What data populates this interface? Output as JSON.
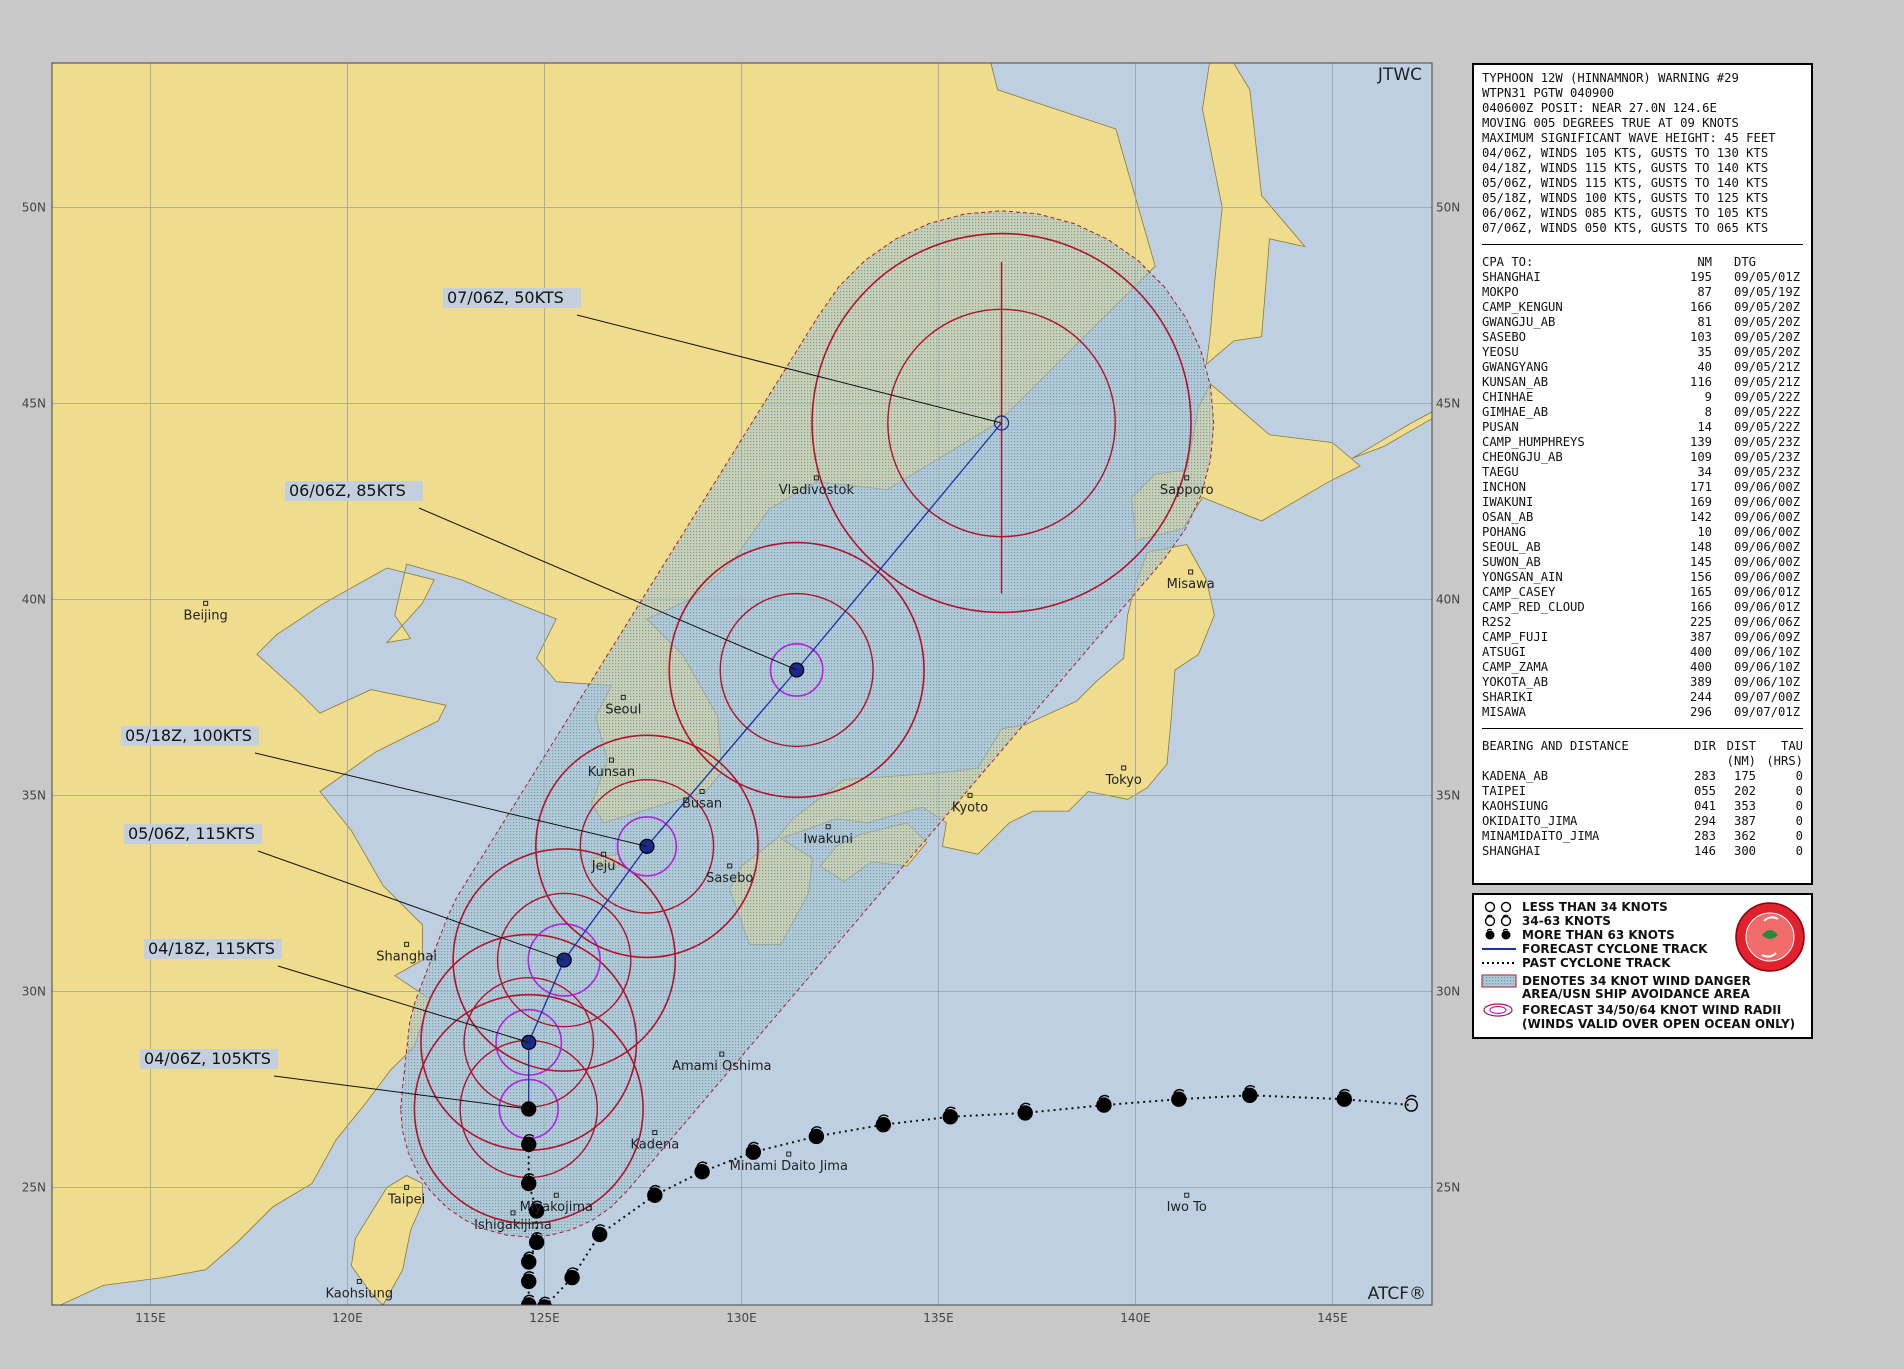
{
  "map": {
    "agency": "JTWC",
    "footer": "ATCF®",
    "lat_labels": [
      "50N",
      "45N",
      "40N",
      "35N",
      "30N",
      "25N"
    ],
    "lon_labels": [
      "115E",
      "120E",
      "125E",
      "130E",
      "135E",
      "140E",
      "145E"
    ],
    "colors": {
      "land": "#efdc8c",
      "sea": "#bdcfe0",
      "danger_area": "#a9c9d6",
      "radii": "#b0142a",
      "inner_radii": "#b023e0",
      "track": "#1a33a6"
    },
    "cities": [
      {
        "name": "Beijing",
        "lon": 116.4,
        "lat": 39.9
      },
      {
        "name": "Shanghai",
        "lon": 121.5,
        "lat": 31.2
      },
      {
        "name": "Taipei",
        "lon": 121.5,
        "lat": 25.0
      },
      {
        "name": "Kaohsiung",
        "lon": 120.3,
        "lat": 22.6
      },
      {
        "name": "Seoul",
        "lon": 127.0,
        "lat": 37.5
      },
      {
        "name": "Kunsan",
        "lon": 126.7,
        "lat": 35.9
      },
      {
        "name": "Busan",
        "lon": 129.0,
        "lat": 35.1
      },
      {
        "name": "Jeju",
        "lon": 126.5,
        "lat": 33.5
      },
      {
        "name": "Sasebo",
        "lon": 129.7,
        "lat": 33.2
      },
      {
        "name": "Iwakuni",
        "lon": 132.2,
        "lat": 34.2
      },
      {
        "name": "Kyoto",
        "lon": 135.8,
        "lat": 35.0
      },
      {
        "name": "Tokyo",
        "lon": 139.7,
        "lat": 35.7
      },
      {
        "name": "Misawa",
        "lon": 141.4,
        "lat": 40.7
      },
      {
        "name": "Sapporo",
        "lon": 141.3,
        "lat": 43.1
      },
      {
        "name": "Vladivostok",
        "lon": 131.9,
        "lat": 43.1
      },
      {
        "name": "Amami Oshima",
        "lon": 129.5,
        "lat": 28.4
      },
      {
        "name": "Kadena",
        "lon": 127.8,
        "lat": 26.4
      },
      {
        "name": "Minami Daito Jima",
        "lon": 131.2,
        "lat": 25.85
      },
      {
        "name": "Iwo To",
        "lon": 141.3,
        "lat": 24.8
      },
      {
        "name": "Miyakojima",
        "lon": 125.3,
        "lat": 24.8
      },
      {
        "name": "Ishigakijima",
        "lon": 124.2,
        "lat": 24.35
      }
    ],
    "forecast_positions": [
      {
        "label": "04/06Z, 105KTS",
        "lon": 124.6,
        "lat": 27.0,
        "r34_nm": 175,
        "r64_nm": 45
      },
      {
        "label": "04/18Z, 115KTS",
        "lon": 124.6,
        "lat": 28.7,
        "r34_nm": 165,
        "r64_nm": 50
      },
      {
        "label": "05/06Z, 115KTS",
        "lon": 125.5,
        "lat": 30.8,
        "r34_nm": 170,
        "r64_nm": 55
      },
      {
        "label": "05/18Z, 100KTS",
        "lon": 127.6,
        "lat": 33.7,
        "r34_nm": 170,
        "r64_nm": 45
      },
      {
        "label": "06/06Z, 85KTS",
        "lon": 131.4,
        "lat": 38.2,
        "r34_nm": 195,
        "r64_nm": 40
      },
      {
        "label": "07/06Z, 50KTS",
        "lon": 136.6,
        "lat": 44.5,
        "r34_nm": 290,
        "r64_nm": 0
      }
    ],
    "past_track": [
      {
        "lon": 124.6,
        "lat": 26.1
      },
      {
        "lon": 124.6,
        "lat": 25.1
      },
      {
        "lon": 124.8,
        "lat": 24.4
      },
      {
        "lon": 124.8,
        "lat": 23.6
      },
      {
        "lon": 124.6,
        "lat": 23.1
      },
      {
        "lon": 124.6,
        "lat": 22.6
      },
      {
        "lon": 124.6,
        "lat": 22.0
      },
      {
        "lon": 125.0,
        "lat": 21.95
      },
      {
        "lon": 125.7,
        "lat": 22.7
      },
      {
        "lon": 126.4,
        "lat": 23.8
      },
      {
        "lon": 127.8,
        "lat": 24.8
      },
      {
        "lon": 129.0,
        "lat": 25.4
      },
      {
        "lon": 130.3,
        "lat": 25.9
      },
      {
        "lon": 131.9,
        "lat": 26.3
      },
      {
        "lon": 133.6,
        "lat": 26.6
      },
      {
        "lon": 135.3,
        "lat": 26.8
      },
      {
        "lon": 137.2,
        "lat": 26.9
      },
      {
        "lon": 139.2,
        "lat": 27.1
      },
      {
        "lon": 141.1,
        "lat": 27.25
      },
      {
        "lon": 142.9,
        "lat": 27.35
      },
      {
        "lon": 145.3,
        "lat": 27.25
      },
      {
        "lon": 147.0,
        "lat": 27.1
      }
    ]
  },
  "warning": {
    "header_lines": [
      "TYPHOON 12W (HINNAMNOR) WARNING #29",
      "WTPN31 PGTW 040900",
      "040600Z POSIT: NEAR 27.0N 124.6E",
      "MOVING 005 DEGREES TRUE AT 09 KNOTS",
      "MAXIMUM SIGNIFICANT WAVE HEIGHT: 45 FEET",
      "04/06Z, WINDS 105 KTS, GUSTS TO 130 KTS",
      "04/18Z, WINDS 115 KTS, GUSTS TO 140 KTS",
      "05/06Z, WINDS 115 KTS, GUSTS TO 140 KTS",
      "05/18Z, WINDS 100 KTS, GUSTS TO 125 KTS",
      "06/06Z, WINDS 085 KTS, GUSTS TO 105 KTS",
      "07/06Z, WINDS 050 KTS, GUSTS TO 065 KTS"
    ],
    "cpa_header": [
      "CPA TO:",
      "NM",
      "DTG"
    ],
    "cpa_rows": [
      [
        "SHANGHAI",
        "195",
        "09/05/01Z"
      ],
      [
        "MOKPO",
        "87",
        "09/05/19Z"
      ],
      [
        "CAMP_KENGUN",
        "166",
        "09/05/20Z"
      ],
      [
        "GWANGJU_AB",
        "81",
        "09/05/20Z"
      ],
      [
        "SASEBO",
        "103",
        "09/05/20Z"
      ],
      [
        "YEOSU",
        "35",
        "09/05/20Z"
      ],
      [
        "GWANGYANG",
        "40",
        "09/05/21Z"
      ],
      [
        "KUNSAN_AB",
        "116",
        "09/05/21Z"
      ],
      [
        "CHINHAE",
        "9",
        "09/05/22Z"
      ],
      [
        "GIMHAE_AB",
        "8",
        "09/05/22Z"
      ],
      [
        "PUSAN",
        "14",
        "09/05/22Z"
      ],
      [
        "CAMP_HUMPHREYS",
        "139",
        "09/05/23Z"
      ],
      [
        "CHEONGJU_AB",
        "109",
        "09/05/23Z"
      ],
      [
        "TAEGU",
        "34",
        "09/05/23Z"
      ],
      [
        "INCHON",
        "171",
        "09/06/00Z"
      ],
      [
        "IWAKUNI",
        "169",
        "09/06/00Z"
      ],
      [
        "OSAN_AB",
        "142",
        "09/06/00Z"
      ],
      [
        "POHANG",
        "10",
        "09/06/00Z"
      ],
      [
        "SEOUL_AB",
        "148",
        "09/06/00Z"
      ],
      [
        "SUWON_AB",
        "145",
        "09/06/00Z"
      ],
      [
        "YONGSAN_AIN",
        "156",
        "09/06/00Z"
      ],
      [
        "CAMP_CASEY",
        "165",
        "09/06/01Z"
      ],
      [
        "CAMP_RED_CLOUD",
        "166",
        "09/06/01Z"
      ],
      [
        "R2S2",
        "225",
        "09/06/06Z"
      ],
      [
        "CAMP_FUJI",
        "387",
        "09/06/09Z"
      ],
      [
        "ATSUGI",
        "400",
        "09/06/10Z"
      ],
      [
        "CAMP_ZAMA",
        "400",
        "09/06/10Z"
      ],
      [
        "YOKOTA_AB",
        "389",
        "09/06/10Z"
      ],
      [
        "SHARIKI",
        "244",
        "09/07/00Z"
      ],
      [
        "MISAWA",
        "296",
        "09/07/01Z"
      ]
    ],
    "bd_header": [
      "BEARING AND DISTANCE",
      "DIR",
      "DIST",
      "TAU"
    ],
    "bd_header2": [
      "",
      "",
      "(NM)",
      "(HRS)"
    ],
    "bd_rows": [
      [
        "KADENA_AB",
        "283",
        "175",
        "0"
      ],
      [
        "TAIPEI",
        "055",
        "202",
        "0"
      ],
      [
        "KAOHSIUNG",
        "041",
        "353",
        "0"
      ],
      [
        "OKIDAITO_JIMA",
        "294",
        "387",
        "0"
      ],
      [
        "MINAMIDAITO_JIMA",
        "283",
        "362",
        "0"
      ],
      [
        "SHANGHAI",
        "146",
        "300",
        "0"
      ]
    ]
  },
  "legend": {
    "items": [
      "LESS THAN 34 KNOTS",
      "34-63 KNOTS",
      "MORE THAN 63 KNOTS",
      "FORECAST CYCLONE TRACK",
      "PAST CYCLONE TRACK",
      "DENOTES 34 KNOT WIND DANGER",
      "AREA/USN SHIP AVOIDANCE AREA",
      "FORECAST 34/50/64 KNOT WIND RADII",
      "(WINDS VALID OVER OPEN OCEAN ONLY)"
    ],
    "seal_icon": "jtwc-seal-icon"
  }
}
